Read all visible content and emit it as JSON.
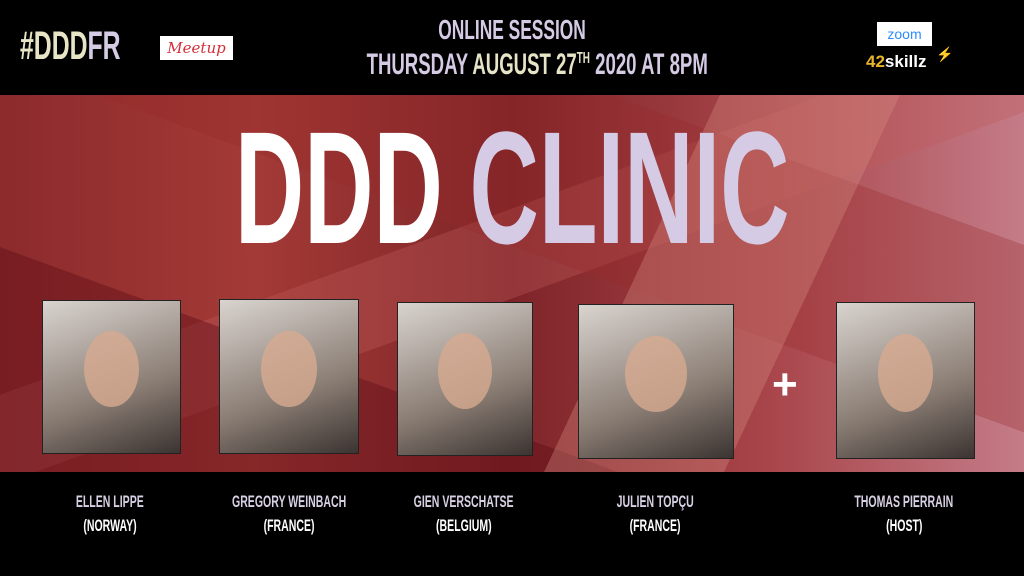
{
  "header": {
    "hashtag_a": "#DDD",
    "hashtag_b": "FR",
    "meetup_logo": "Meetup",
    "session": "ONLINE SESSION",
    "date_a": "THURSDAY",
    "date_b": "AUGUST 27",
    "date_sup": "TH",
    "date_c": "2020 AT 8PM",
    "zoom_logo": "zoom",
    "skillz_a": "42",
    "skillz_b": "skillz"
  },
  "title": {
    "part1": "DDD",
    "part2": "CLINIC"
  },
  "plus": "+",
  "speakers": [
    {
      "name": "ELLEN LIPPE",
      "country": "(NORWAY)"
    },
    {
      "name": "GREGORY WEINBACH",
      "country": "(FRANCE)"
    },
    {
      "name": "GIEN VERSCHATSE",
      "country": "(BELGIUM)"
    },
    {
      "name": "JULIEN TOPÇU",
      "country": "(FRANCE)"
    },
    {
      "name": "THOMAS PIERRAIN",
      "country": "(HOST)"
    }
  ],
  "colors": {
    "lavender": "#d5cbe5",
    "cream": "#e7e5c6",
    "background": "#000000"
  }
}
